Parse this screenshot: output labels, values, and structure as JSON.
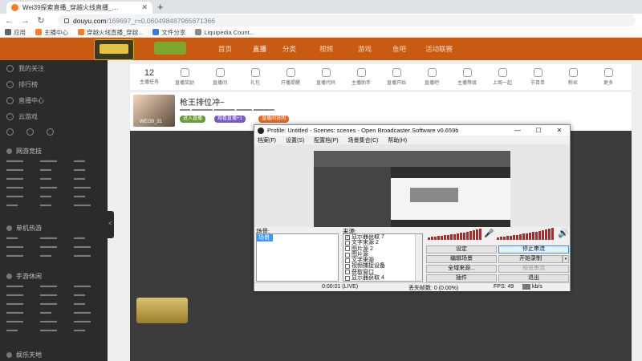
{
  "browser": {
    "tab_title": "Wei39探索直播_穿越火线直播_…",
    "url_host": "douyu.com",
    "url_path": "/169697_r=0.060498487965671366",
    "bookmarks": [
      "应用",
      "主播中心",
      "穿越火线直播_穿越...",
      "文件分享",
      "Liquipedia Count..."
    ]
  },
  "site": {
    "nav": [
      "首页",
      "直播",
      "分类",
      "视频",
      "游戏",
      "鱼吧",
      "活动联赛"
    ],
    "icons": [
      {
        "label": "主播任务",
        "num": "12"
      },
      {
        "label": "直播奖励",
        "num": ""
      },
      {
        "label": "直播间",
        "num": ""
      },
      {
        "label": "礼包",
        "num": ""
      },
      {
        "label": "开播提醒",
        "num": ""
      },
      {
        "label": "直播代码",
        "num": ""
      },
      {
        "label": "主播助手",
        "num": ""
      },
      {
        "label": "直播开始",
        "num": ""
      },
      {
        "label": "直播吧",
        "num": ""
      },
      {
        "label": "主播等级",
        "num": ""
      },
      {
        "label": "上周一起",
        "num": ""
      },
      {
        "label": "节目单",
        "num": ""
      },
      {
        "label": "粉丝",
        "num": ""
      },
      {
        "label": "更多",
        "num": ""
      }
    ],
    "streamer_title": "枪王排位冲~",
    "avatar_name": "WEI39_31",
    "badges": [
      "进入直播",
      "观看直播+1",
      "直播间说明"
    ]
  },
  "sidebar": {
    "items": [
      "我的关注",
      "排行榜",
      "直播中心",
      "云游戏"
    ],
    "heads": [
      "网游竞技",
      "单机热游",
      "手游休闲",
      "娱乐天地"
    ]
  },
  "obs": {
    "title": "Profile: Untitled - Scenes: scenes - Open Broadcaster Software v0.659b",
    "menu": [
      "档案(F)",
      "设置(S)",
      "配置档(P)",
      "场景集合(C)",
      "帮助(H)"
    ],
    "scenes_label": "场景:",
    "sources_label": "来源:",
    "scene_selected": "场景",
    "sources": [
      "显示器获取 7",
      "文字来源 2",
      "图片源 2",
      "图片源",
      "文字来源",
      "视频捕捉设备",
      "获取窗口",
      "显示器获取 4"
    ],
    "buttons": {
      "settings": "设定",
      "stop_stream": "停止串流",
      "edit_scene": "编辑场景",
      "start_record": "开始录制",
      "global_sources": "全域来源...",
      "preview_stream": "预览串流",
      "plugins": "插件",
      "exit": "退出"
    },
    "status": {
      "time": "0:00:01 (LIVE)",
      "dropped": "丢失帧数: 0 (0.00%)",
      "fps": "FPS: 49",
      "bitrate": "kb/s"
    }
  }
}
